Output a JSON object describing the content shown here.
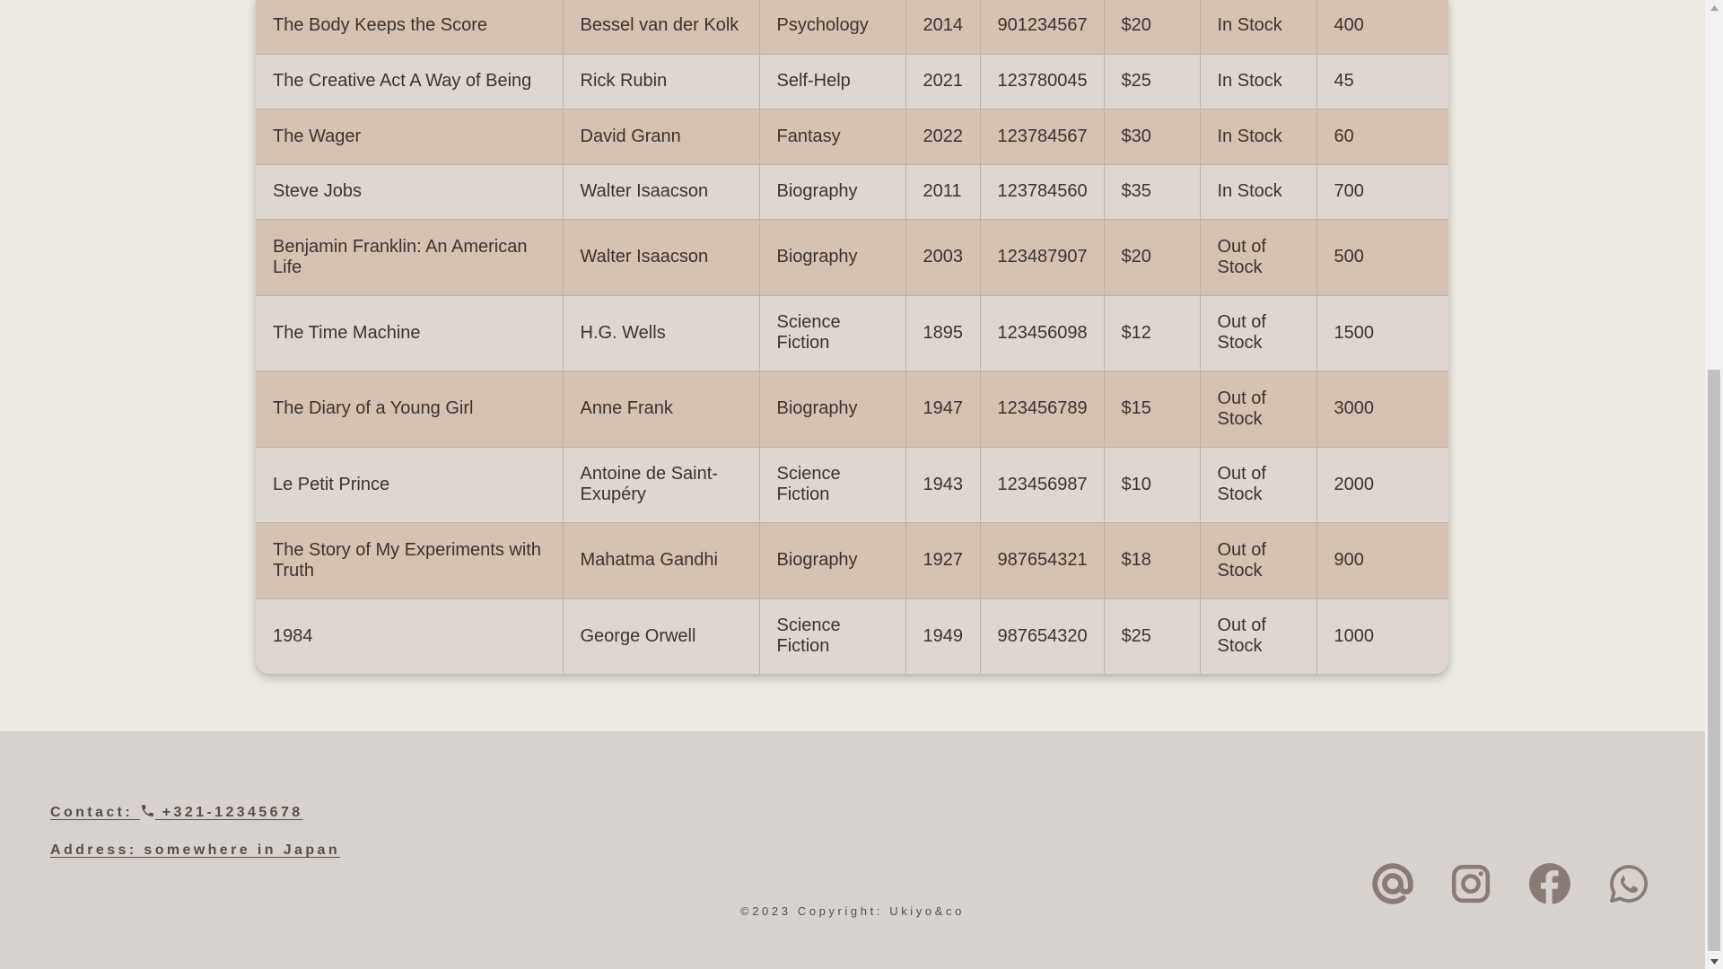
{
  "books": [
    {
      "title": "The Body Keeps the Score",
      "author": "Bessel van der Kolk",
      "genre": "Psychology",
      "year": "2014",
      "isbn": "901234567",
      "price": "$20",
      "status": "In Stock",
      "quantity": "400"
    },
    {
      "title": "The Creative Act A Way of Being",
      "author": "Rick Rubin",
      "genre": "Self-Help",
      "year": "2021",
      "isbn": "123780045",
      "price": "$25",
      "status": "In Stock",
      "quantity": "45"
    },
    {
      "title": "The Wager",
      "author": "David Grann",
      "genre": "Fantasy",
      "year": "2022",
      "isbn": "123784567",
      "price": "$30",
      "status": "In Stock",
      "quantity": "60"
    },
    {
      "title": "Steve Jobs",
      "author": "Walter Isaacson",
      "genre": "Biography",
      "year": "2011",
      "isbn": "123784560",
      "price": "$35",
      "status": "In Stock",
      "quantity": "700"
    },
    {
      "title": "Benjamin Franklin: An American Life",
      "author": "Walter Isaacson",
      "genre": "Biography",
      "year": "2003",
      "isbn": "123487907",
      "price": "$20",
      "status": "Out of Stock",
      "quantity": "500"
    },
    {
      "title": "The Time Machine",
      "author": "H.G. Wells",
      "genre": "Science Fiction",
      "year": "1895",
      "isbn": "123456098",
      "price": "$12",
      "status": "Out of Stock",
      "quantity": "1500"
    },
    {
      "title": "The Diary of a Young Girl",
      "author": "Anne Frank",
      "genre": "Biography",
      "year": "1947",
      "isbn": "123456789",
      "price": "$15",
      "status": "Out of Stock",
      "quantity": "3000"
    },
    {
      "title": "Le Petit Prince",
      "author": "Antoine de Saint-Exupéry",
      "genre": "Science Fiction",
      "year": "1943",
      "isbn": "123456987",
      "price": "$10",
      "status": "Out of Stock",
      "quantity": "2000"
    },
    {
      "title": "The Story of My Experiments with Truth",
      "author": "Mahatma Gandhi",
      "genre": "Biography",
      "year": "1927",
      "isbn": "987654321",
      "price": "$18",
      "status": "Out of Stock",
      "quantity": "900"
    },
    {
      "title": "1984",
      "author": "George Orwell",
      "genre": "Science Fiction",
      "year": "1949",
      "isbn": "987654320",
      "price": "$25",
      "status": "Out of Stock",
      "quantity": "1000"
    }
  ],
  "footer": {
    "contact_prefix": "Contact: ",
    "phone": " +321-12345678",
    "address": "Address: somewhere in Japan",
    "copyright": "©2023 Copyright: Ukiyo&co",
    "socials": [
      {
        "name": "email",
        "icon": "at-sign-icon"
      },
      {
        "name": "instagram",
        "icon": "instagram-icon"
      },
      {
        "name": "facebook",
        "icon": "facebook-icon"
      },
      {
        "name": "whatsapp",
        "icon": "whatsapp-icon"
      }
    ]
  },
  "colors": {
    "row_odd": "#d5c2b2",
    "row_even": "#dfd6d0",
    "footer_bg": "#d8d2cf",
    "page_bg": "#ede9e3",
    "icon": "#8a7b74"
  }
}
